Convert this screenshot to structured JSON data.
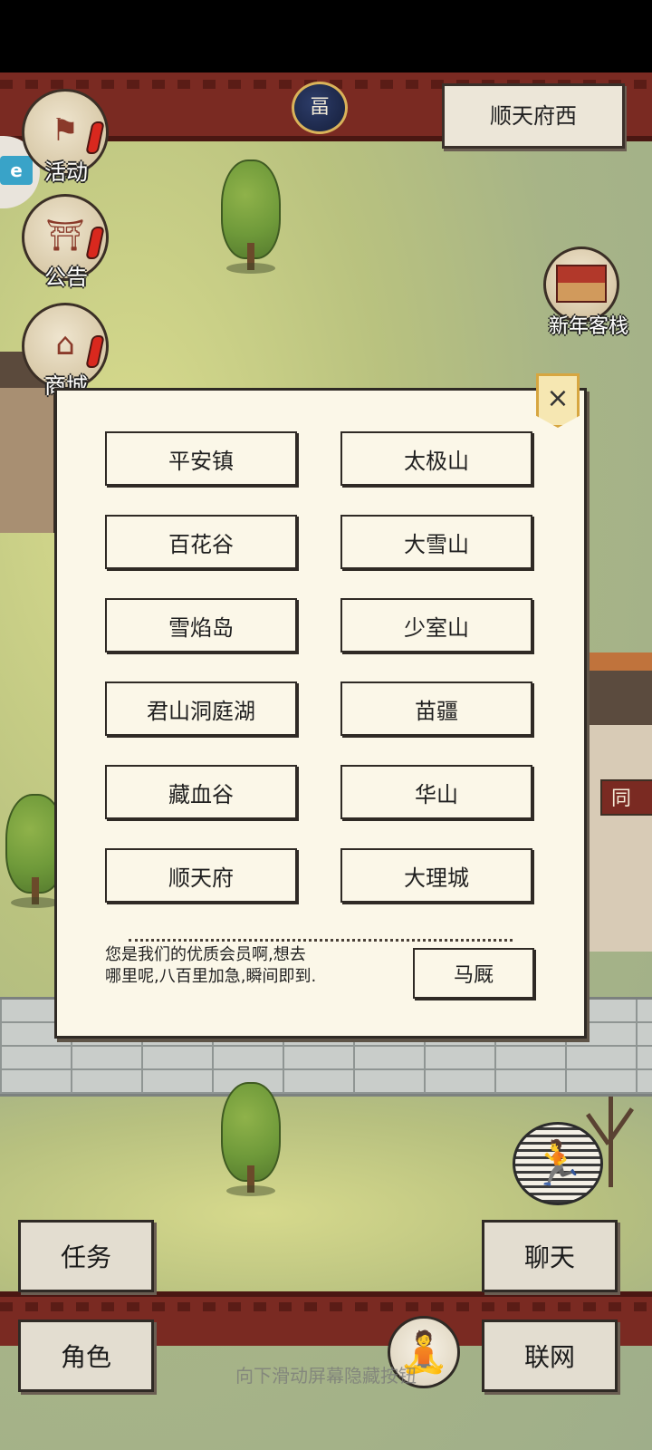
{
  "header": {
    "location": "顺天府西",
    "moon_glyph": "畐"
  },
  "sidebar": {
    "items": [
      {
        "label": "活动",
        "icon": "flag-icon"
      },
      {
        "label": "公告",
        "icon": "notice-board-icon"
      },
      {
        "label": "商城",
        "icon": "shop-icon"
      }
    ],
    "ad_chip": "e"
  },
  "map": {
    "inn_label": "新年客栈",
    "house_sign": "同"
  },
  "dialog": {
    "close_label": "×",
    "destinations": [
      "平安镇",
      "太极山",
      "百花谷",
      "大雪山",
      "雪焰岛",
      "少室山",
      "君山洞庭湖",
      "苗疆",
      "藏血谷",
      "华山",
      "顺天府",
      "大理城"
    ],
    "message_line1": "您是我们的优质会员啊,想去",
    "message_line2": "哪里呢,八百里加急,瞬间即到.",
    "horse_button": "马厩"
  },
  "bottom": {
    "task": "任务",
    "chat": "聊天",
    "role": "角色",
    "network": "联网",
    "hint": "向下滑动屏幕隐藏按钮"
  },
  "colors": {
    "wall_red": "#7a2a22",
    "paper": "#fbf7e8",
    "ink": "#2f2a25"
  }
}
